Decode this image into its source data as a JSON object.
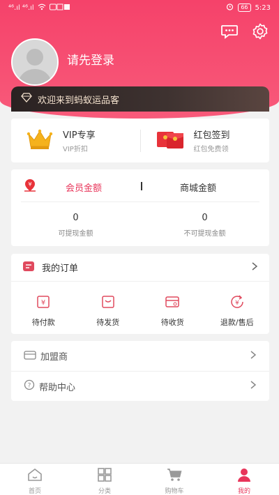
{
  "status_bar": {
    "left": "⁴⁶.ıl ⁴⁶.ıl",
    "battery": "66",
    "time": "5:23"
  },
  "profile": {
    "login_prompt": "请先登录"
  },
  "welcome": {
    "text": "欢迎来到蚂蚁运品客"
  },
  "vip": {
    "left": {
      "title": "VIP专享",
      "sub": "VIP折扣"
    },
    "right": {
      "title": "红包签到",
      "sub": "红包免费领"
    }
  },
  "balance": {
    "tab_member": "会员金额",
    "tab_mall": "商城金额",
    "withdrawable_value": "0",
    "withdrawable_label": "可提现金额",
    "non_withdrawable_value": "0",
    "non_withdrawable_label": "不可提现金额"
  },
  "orders": {
    "title": "我的订单",
    "items": [
      {
        "label": "待付款",
        "icon": "pending-payment-icon"
      },
      {
        "label": "待发货",
        "icon": "pending-shipment-icon"
      },
      {
        "label": "待收货",
        "icon": "pending-receipt-icon"
      },
      {
        "label": "退款/售后",
        "icon": "refund-icon"
      }
    ]
  },
  "menu": [
    {
      "label": "加盟商",
      "icon": "franchise-icon"
    },
    {
      "label": "帮助中心",
      "icon": "help-icon"
    }
  ],
  "tabbar": [
    {
      "label": "首页",
      "icon": "home-icon"
    },
    {
      "label": "分类",
      "icon": "category-icon"
    },
    {
      "label": "购物车",
      "icon": "cart-icon"
    },
    {
      "label": "我的",
      "icon": "profile-icon"
    }
  ],
  "colors": {
    "brand": "#f5426a",
    "active": "#e8355a"
  }
}
